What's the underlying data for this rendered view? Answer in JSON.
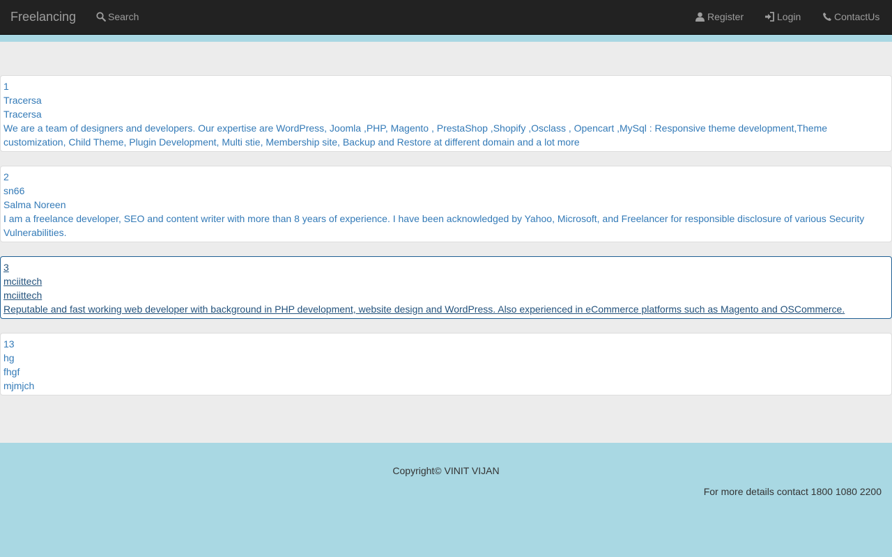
{
  "colors": {
    "navbar_bg": "#222222",
    "nav_text": "#9d9d9d",
    "accent": "#a9d8e3",
    "link": "#337ab7",
    "link_hover": "#23527c",
    "page_bg": "#ececec"
  },
  "navbar": {
    "brand": "Freelancing",
    "search": {
      "label": "Search",
      "icon": "search-icon"
    },
    "register": {
      "label": "Register",
      "icon": "user-icon"
    },
    "login": {
      "label": "Login",
      "icon": "login-icon"
    },
    "contact": {
      "label": "ContactUs",
      "icon": "phone-icon"
    }
  },
  "freelancers": [
    {
      "id": "1",
      "username": "Tracersa",
      "name": "Tracersa",
      "description": "We are a team of designers and developers. Our expertise are WordPress, Joomla ,PHP, Magento , PrestaShop ,Shopify ,Osclass , Opencart ,MySql : Responsive theme development,Theme customization, Child Theme, Plugin Development, Multi stie, Membership site, Backup and Restore at different domain and a lot more"
    },
    {
      "id": "2",
      "username": "sn66",
      "name": "Salma Noreen",
      "description": "I am a freelance developer, SEO and content writer with more than 8 years of experience. I have been acknowledged by Yahoo, Microsoft, and Freelancer for responsible disclosure of various Security Vulnerabilities."
    },
    {
      "id": "3",
      "username": "mciittech",
      "name": "mciittech",
      "description": "Reputable and fast working web developer with background in PHP development, website design and WordPress. Also experienced in eCommerce platforms such as Magento and OSCommerce."
    },
    {
      "id": "13",
      "username": "hg",
      "name": "fhgf",
      "description": "mjmjch"
    }
  ],
  "footer": {
    "copyright": "Copyright© VINIT VIJAN",
    "contact": "For more details contact 1800 1080 2200"
  }
}
